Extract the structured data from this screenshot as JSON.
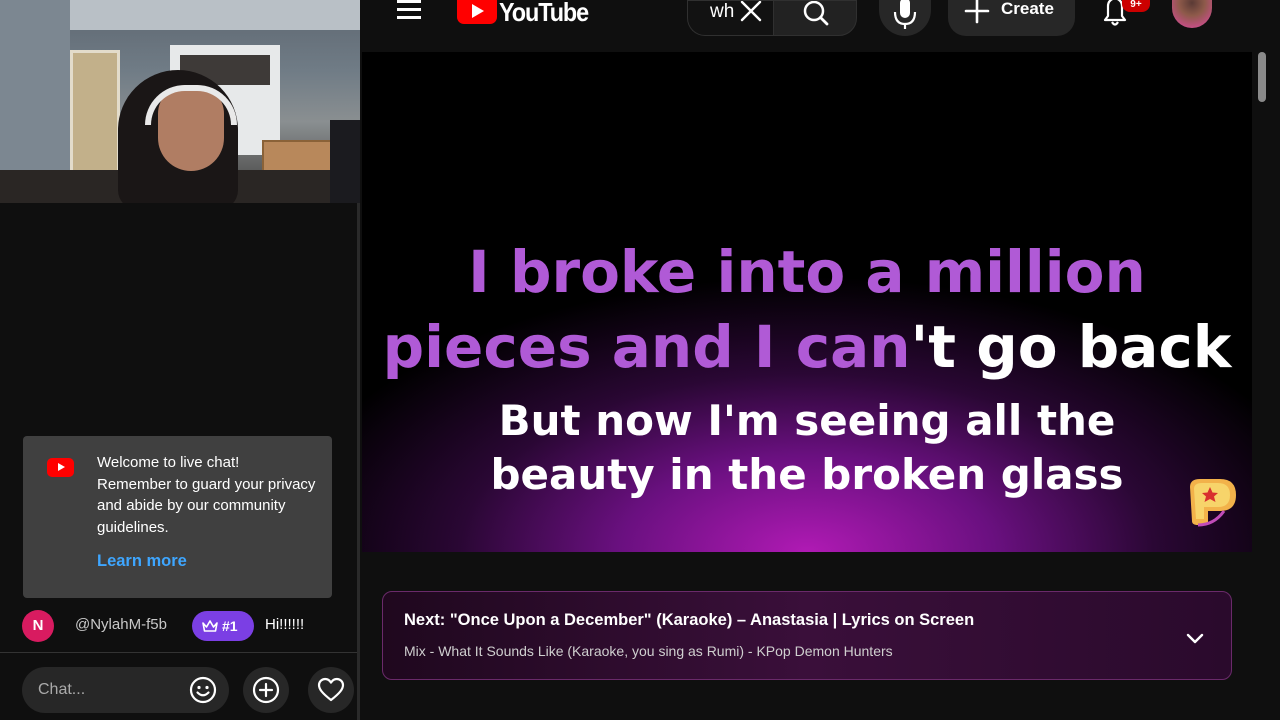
{
  "webcam": {
    "alt": "streamer webcam"
  },
  "chat": {
    "welcome_message": "Welcome to live chat! Remember to guard your privacy and abide by our community guidelines.",
    "learn_more": "Learn more",
    "message": {
      "avatar_letter": "N",
      "author": "@NylahM-f5b",
      "badge": "#1",
      "text": "Hi!!!!!!"
    },
    "input_placeholder": "Chat..."
  },
  "header": {
    "logo_text": "YouTube",
    "search_query": "wh",
    "create_label": "Create",
    "notification_count": "9+"
  },
  "player": {
    "lyric_line_1": "I broke into a million",
    "lyric_line_2_sung": "pieces and I can",
    "lyric_line_2_rest": "'t go back",
    "lyric_line_3": "But now I'm seeing all the",
    "lyric_line_4": "beauty in the broken glass"
  },
  "up_next": {
    "title": "Next: \"Once Upon a December\" (Karaoke) – Anastasia | Lyrics on Screen",
    "subtitle": "Mix - What It Sounds Like (Karaoke, you sing as Rumi) - KPop Demon Hunters"
  },
  "colors": {
    "lyric_sung": "#b05ad6",
    "lyric_unsung": "#ffffff",
    "brand_red": "#ff0000",
    "link_blue": "#3ea6ff",
    "badge_purple": "#7b3fe4"
  },
  "icons": [
    "menu-icon",
    "youtube-logo-icon",
    "clear-icon",
    "search-icon",
    "mic-icon",
    "plus-icon",
    "bell-icon",
    "emoji-icon",
    "add-icon",
    "heart-icon",
    "crown-icon",
    "chevron-down-icon"
  ]
}
